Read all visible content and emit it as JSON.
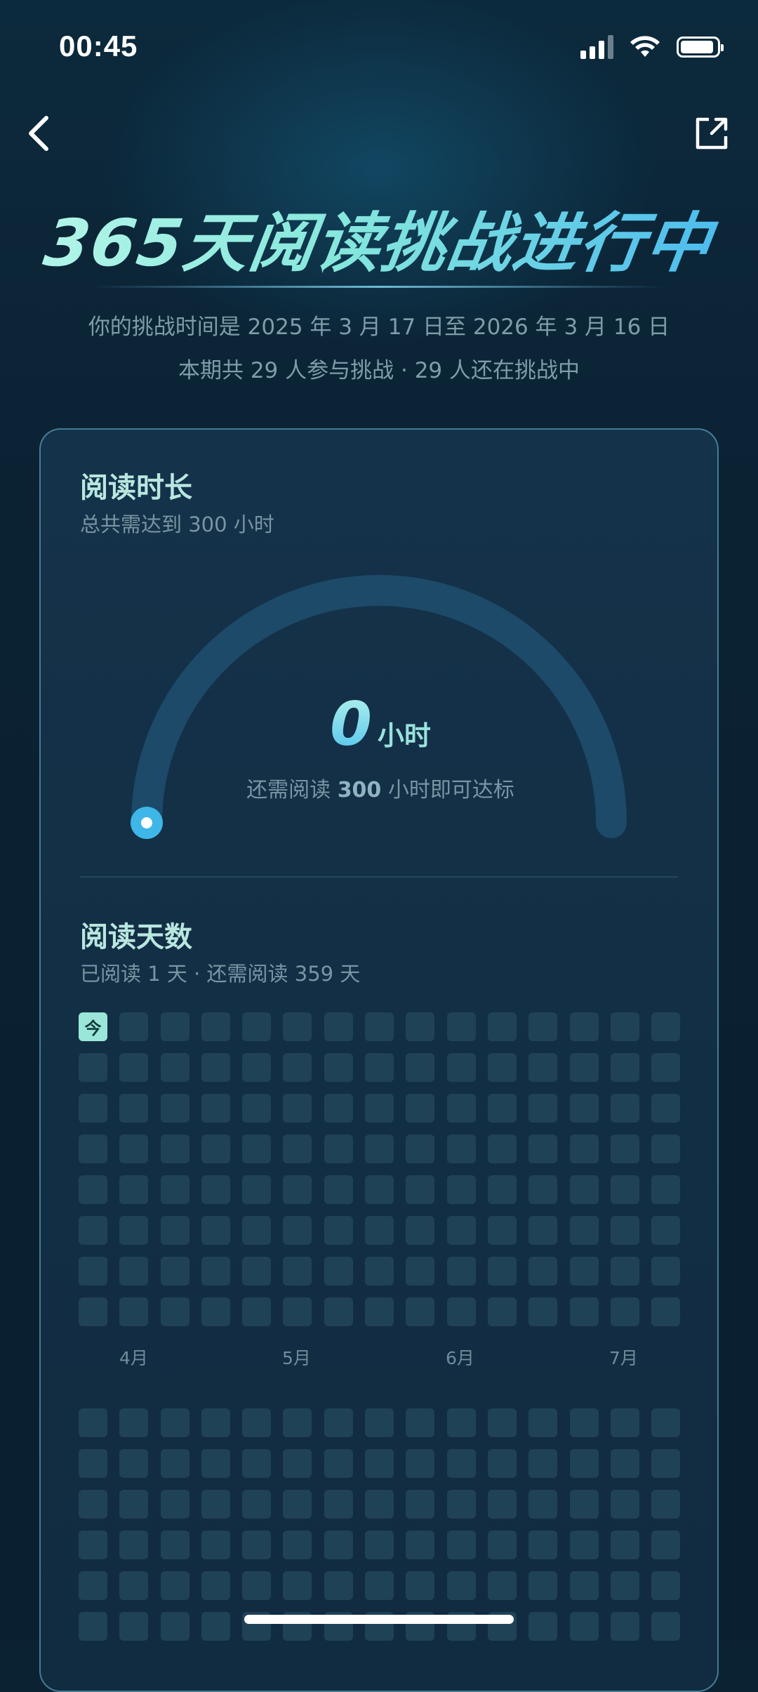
{
  "status_bar": {
    "time": "00:45"
  },
  "header": {
    "title": "365天阅读挑战进行中",
    "period_text": "你的挑战时间是 2025 年 3 月 17 日至 2026 年 3 月 16 日",
    "participants_text": "本期共 29 人参与挑战 · 29 人还在挑战中"
  },
  "reading_time": {
    "title": "阅读时长",
    "subtitle": "总共需达到 300 小时",
    "value": "0",
    "unit": "小时",
    "remain_prefix": "还需阅读 ",
    "remain_value": "300",
    "remain_suffix": " 小时即可达标",
    "progress_fraction": 0
  },
  "reading_days": {
    "title": "阅读天数",
    "subtitle": "已阅读 1 天 · 还需阅读 359 天",
    "today_label": "今",
    "months": [
      "4月",
      "5月",
      "6月",
      "7月"
    ]
  },
  "colors": {
    "accent": "#3fb6e8",
    "today_cell": "#9ae6d9",
    "empty_cell": "#1f4257",
    "track": "#1c4a68"
  }
}
